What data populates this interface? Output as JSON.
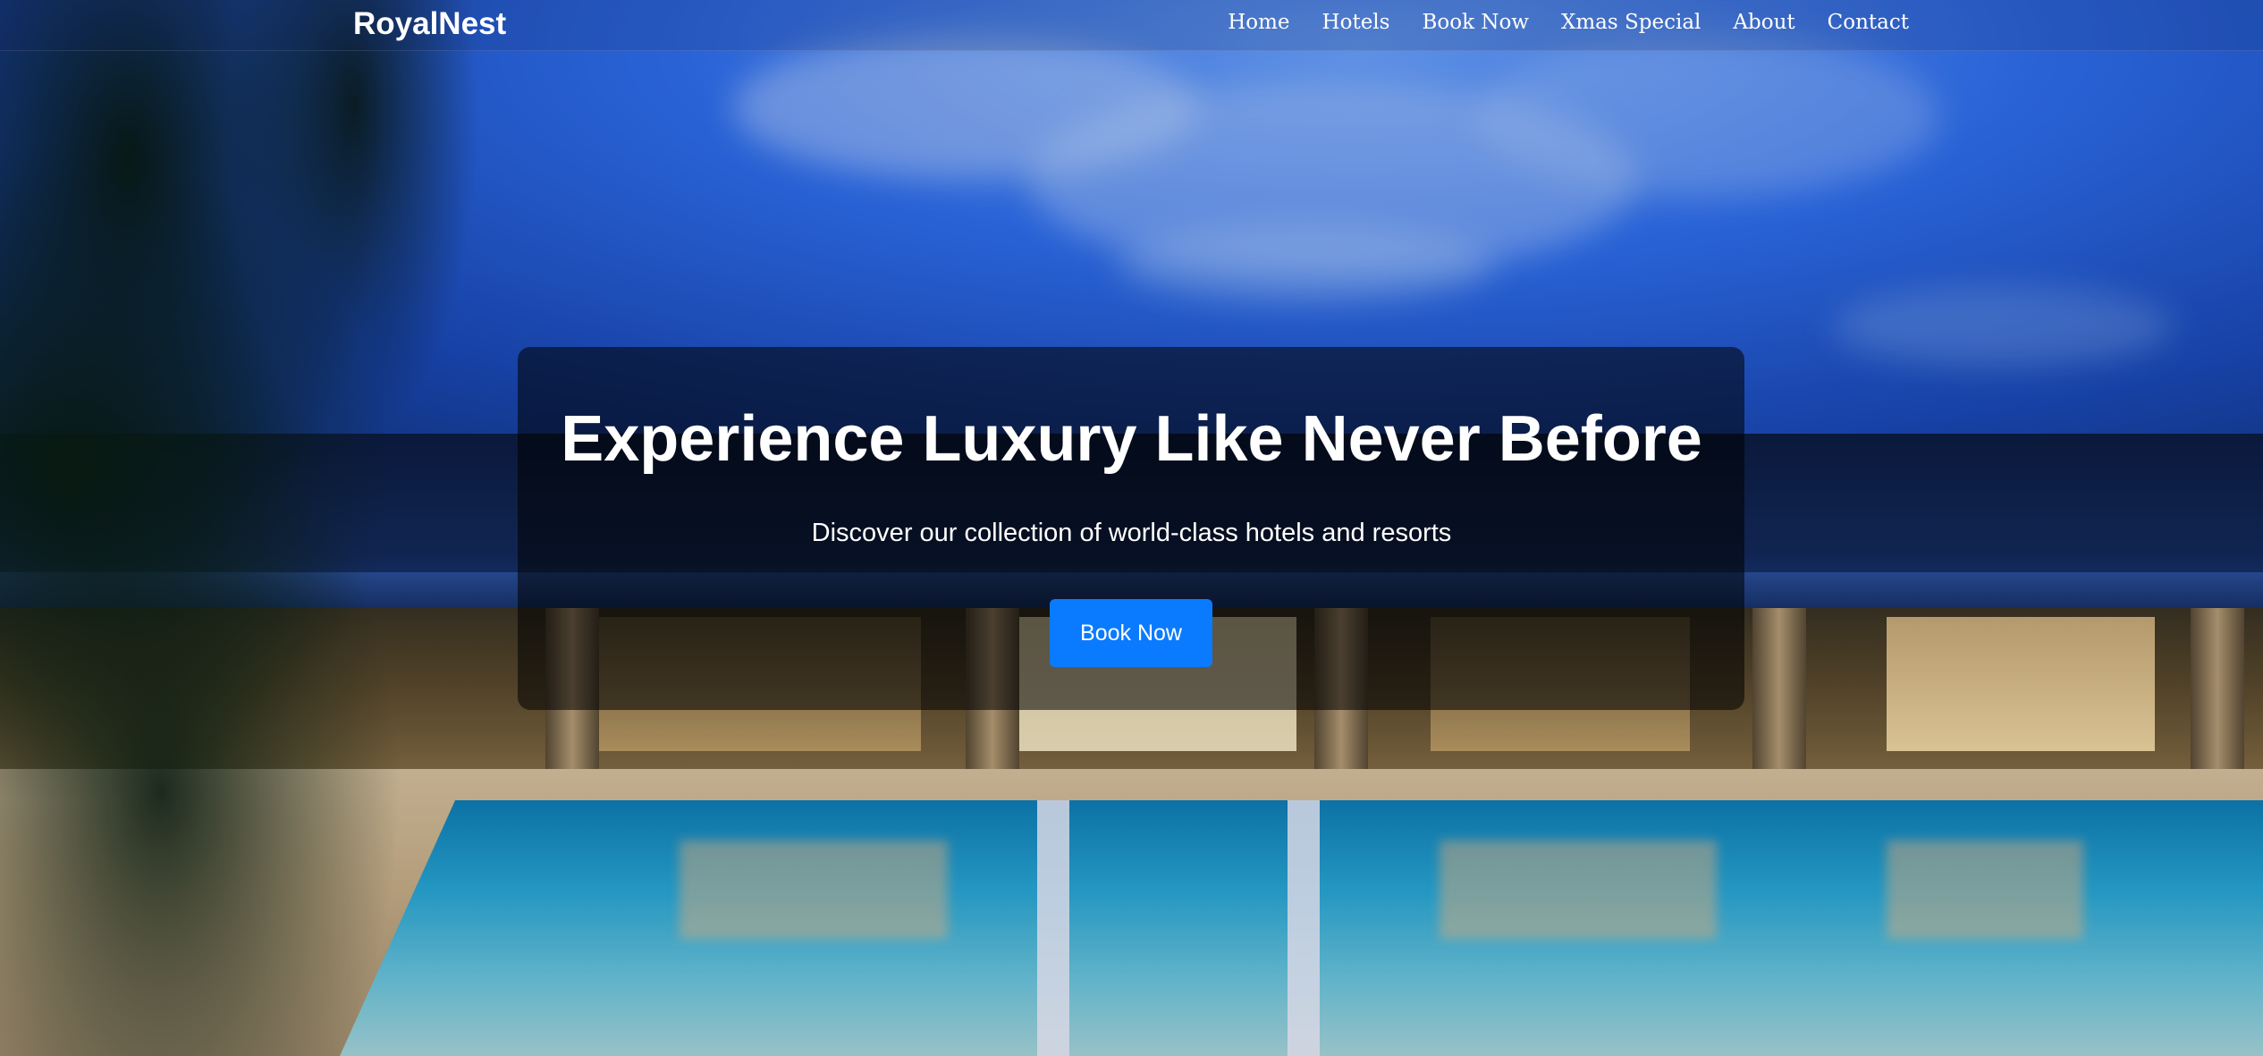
{
  "navbar": {
    "brand": "RoyalNest",
    "links": [
      {
        "label": "Home"
      },
      {
        "label": "Hotels"
      },
      {
        "label": "Book Now"
      },
      {
        "label": "Xmas Special"
      },
      {
        "label": "About"
      },
      {
        "label": "Contact"
      }
    ]
  },
  "hero": {
    "title": "Experience Luxury Like Never Before",
    "subtitle": "Discover our collection of world-class hotels and resorts",
    "cta_label": "Book Now",
    "background_image": "resort-pool-at-dusk"
  },
  "colors": {
    "cta": "#0a7bff",
    "text": "#ffffff",
    "panel_overlay": "rgba(0,0,0,0.55)"
  }
}
